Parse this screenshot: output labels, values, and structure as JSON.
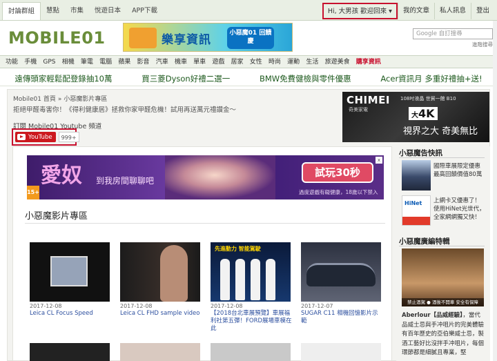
{
  "topbar": {
    "tabs": [
      "討論群組",
      "慧點",
      "市集",
      "悅遊日本",
      "APP下載"
    ],
    "welcome": "Hi, 大男孩 歡迎回來 ▾",
    "links": [
      "我的文章",
      "私人訊息",
      "登出"
    ]
  },
  "header": {
    "logo": "MOBILE01",
    "banner_title": "樂享資訊",
    "banner_badge": "小惡魔01 回饋慶",
    "search_placeholder": "Google 自訂搜尋",
    "advanced_search": "進階搜尋"
  },
  "nav": {
    "items": [
      "功能",
      "手機",
      "GPS",
      "相機",
      "筆電",
      "電腦",
      "蘋果",
      "影音",
      "汽車",
      "機車",
      "單車",
      "遊戲",
      "居家",
      "女性",
      "時尚",
      "運動",
      "生活",
      "旅遊美食"
    ],
    "hot_item": "購享資訊"
  },
  "promos": [
    "遠傳頭家輕鬆配登錄抽10萬",
    "買三菱Dyson好禮二選一",
    "BMW免費健檢與零件優惠",
    "Acer資訊月 多重好禮抽+送!"
  ],
  "breadcrumb": {
    "home": "Mobile01 首頁",
    "sep": "»",
    "current": "小惡魔影片專區"
  },
  "subtitle": "拒絕甲醛毒害你！《得利健康居》拯救你家甲醛危機！試用再送萬元禮讚金～",
  "subscribe": {
    "title": "訂閱 Mobile01 Youtube 頻道",
    "button": "YouTube",
    "count": "999+"
  },
  "chimei_ad": {
    "brand": "CHIMEI",
    "brand_sub": "奇美家電",
    "info": "108吋液晶 世貿一館 B10",
    "resolution": "4K",
    "resolution_suffix": "大",
    "slogan": "視界之大 奇美無比"
  },
  "game_ad": {
    "title": "愛奴",
    "tagline": "到我房間聊聊吧",
    "cta": "試玩30秒",
    "note": "過度遊戲有礙健康，18歲以下禁入",
    "rating": "15+",
    "close": "x"
  },
  "section_title": "小惡魔影片專區",
  "videos": [
    {
      "date": "2017-12-08",
      "title": "Leica CL Focus Speed"
    },
    {
      "date": "2017-12-08",
      "title": "Leica CL FHD sample video"
    },
    {
      "date": "2017-12-08",
      "title": "【2018台北車展預覽】車展福利社第五彈！FORD展場車模在此",
      "thumb_text": "先進動力 智能駕駛"
    },
    {
      "date": "2017-12-07",
      "title": "SUGAR C11 相機回憶影片示範"
    }
  ],
  "sidebar": {
    "news_title": "小惡魔告快訊",
    "news": [
      {
        "text": "國際車展限定優惠 最高回饋價值80萬"
      },
      {
        "text": "上網卡又優惠了！使用HiNet光世代，全家網網獨又快！"
      }
    ],
    "feature_title": "小惡魔廣編特輯",
    "feature_image_label": "禁止酒駕 ● 酒後不開車 安全有保障",
    "feature_highlight": "Aberlour【品威經驗】",
    "feature_text": "，當代品威士忌與手冲咀片的完美體驗 有百年歷史的亞伯樂威士忌，製酒工藝好比沒拌手冲咀片，每個環節都是細膩且專業，堅"
  }
}
